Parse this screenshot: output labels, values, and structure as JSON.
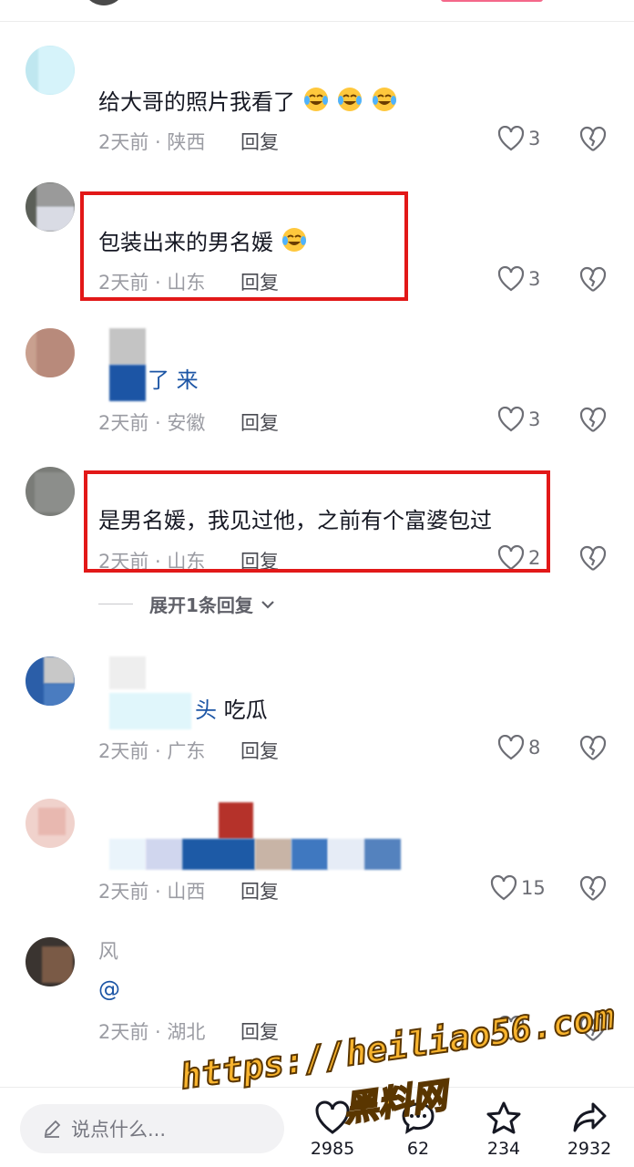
{
  "comments": [
    {
      "text": "给大哥的照片我看了",
      "time": "2天前 · 陕西",
      "reply": "回复",
      "likes": "3",
      "emoji_count": 3
    },
    {
      "text": "包装出来的男名媛",
      "time": "2天前 · 山东",
      "reply": "回复",
      "likes": "3"
    },
    {
      "text_partial": "了 来",
      "time": "2天前 · 安徽",
      "reply": "回复",
      "likes": "3"
    },
    {
      "text": "是男名媛，我见过他，之前有个富婆包过",
      "time": "2天前 · 山东",
      "reply": "回复",
      "likes": "2"
    },
    {
      "text_partial_a": "头",
      "text_partial_b": "吃瓜",
      "time": "2天前 · 广东",
      "reply": "回复",
      "likes": "8"
    },
    {
      "time": "2天前 · 山西",
      "reply": "回复",
      "likes": "15"
    },
    {
      "username_partial": "风",
      "text_partial": "@",
      "time": "2天前 · 湖北",
      "reply": "回复"
    }
  ],
  "expand_replies": "展开1条回复",
  "bottom_bar": {
    "input_placeholder": "说点什么...",
    "likes": "2985",
    "comments": "62",
    "favorites": "234",
    "shares": "2932"
  },
  "watermark": {
    "url": "https://heiliao56.com",
    "name": "黑料网"
  },
  "colors": {
    "highlight_box": "#e21818",
    "watermark_fill": "#f8b42e",
    "meta_text": "#9b9ca3"
  }
}
